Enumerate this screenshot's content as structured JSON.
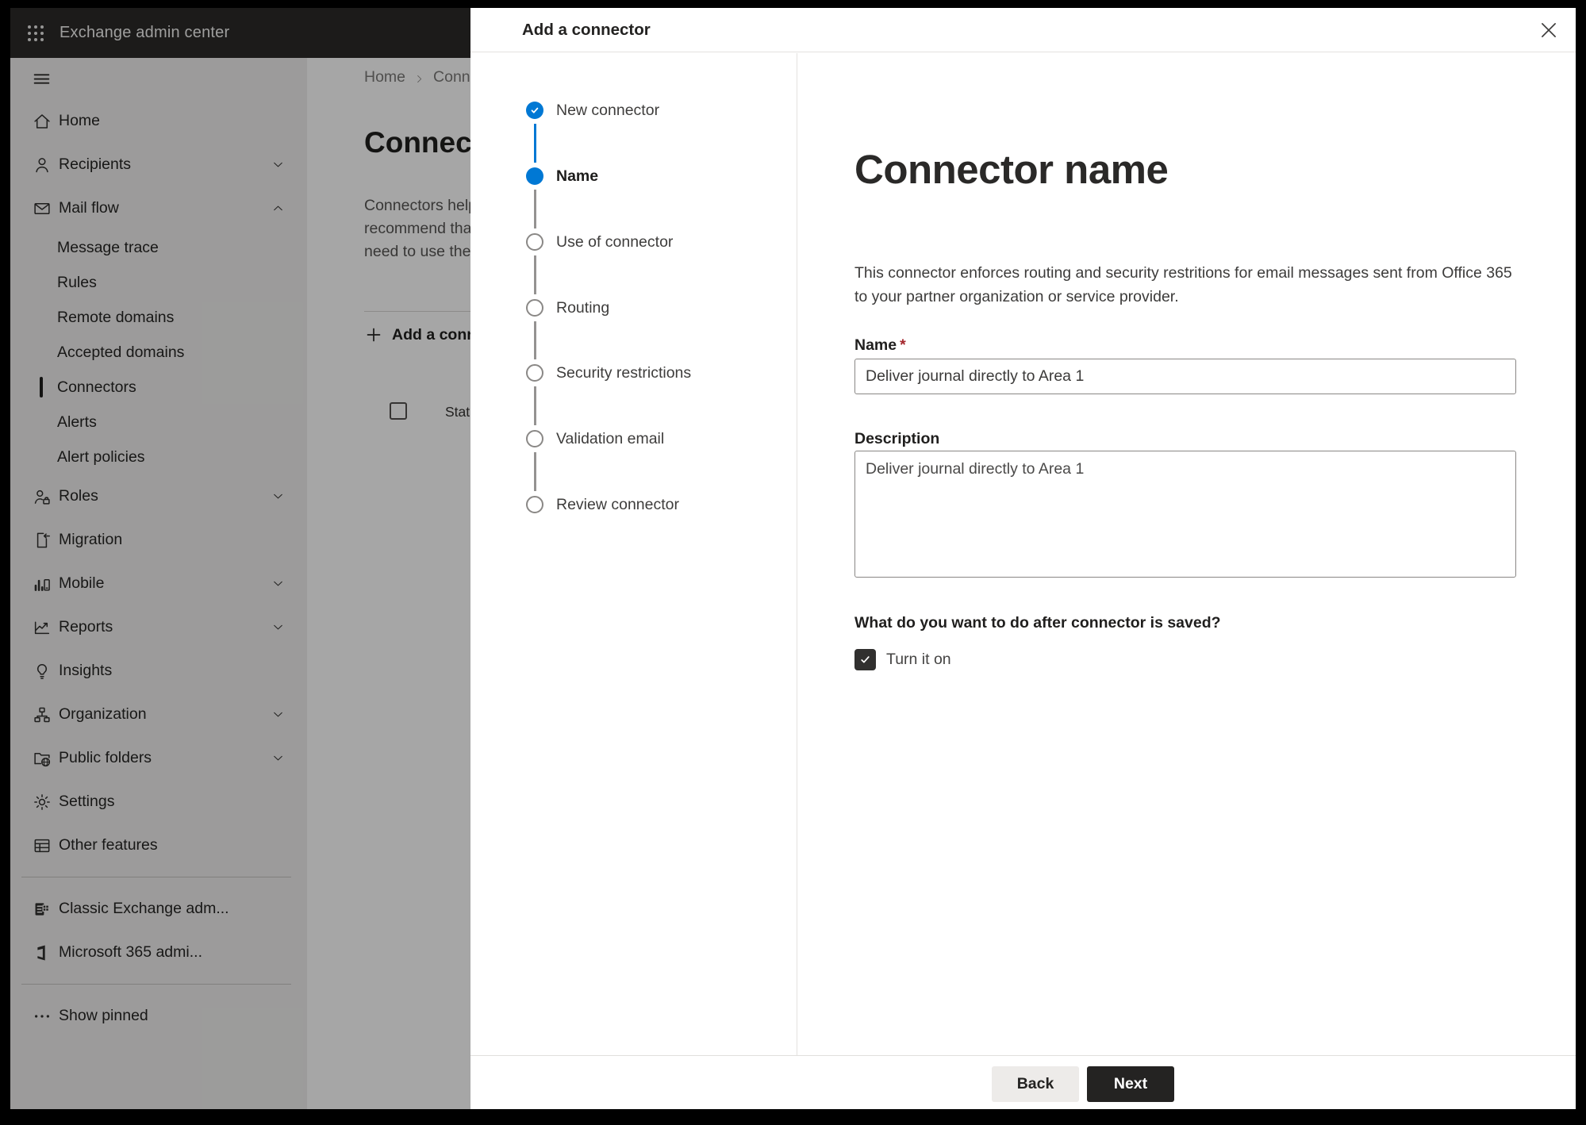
{
  "topbar": {
    "title": "Exchange admin center"
  },
  "sidebar": {
    "items": [
      {
        "type": "top",
        "label": "Home",
        "icon": "home-icon"
      },
      {
        "type": "top",
        "label": "Recipients",
        "icon": "person-icon",
        "chevron": "down"
      },
      {
        "type": "top",
        "label": "Mail flow",
        "icon": "mail-icon",
        "chevron": "up"
      },
      {
        "type": "sub",
        "label": "Message trace"
      },
      {
        "type": "sub",
        "label": "Rules"
      },
      {
        "type": "sub",
        "label": "Remote domains"
      },
      {
        "type": "sub",
        "label": "Accepted domains"
      },
      {
        "type": "sub",
        "label": "Connectors",
        "selected": true
      },
      {
        "type": "sub",
        "label": "Alerts"
      },
      {
        "type": "sub",
        "label": "Alert policies"
      },
      {
        "type": "top",
        "label": "Roles",
        "icon": "roles-icon",
        "chevron": "down"
      },
      {
        "type": "top",
        "label": "Migration",
        "icon": "migration-icon"
      },
      {
        "type": "top",
        "label": "Mobile",
        "icon": "mobile-icon",
        "chevron": "down"
      },
      {
        "type": "top",
        "label": "Reports",
        "icon": "reports-icon",
        "chevron": "down"
      },
      {
        "type": "top",
        "label": "Insights",
        "icon": "insights-icon"
      },
      {
        "type": "top",
        "label": "Organization",
        "icon": "organization-icon",
        "chevron": "down"
      },
      {
        "type": "top",
        "label": "Public folders",
        "icon": "public-folders-icon",
        "chevron": "down"
      },
      {
        "type": "top",
        "label": "Settings",
        "icon": "settings-icon"
      },
      {
        "type": "top",
        "label": "Other features",
        "icon": "other-features-icon"
      },
      {
        "type": "divider"
      },
      {
        "type": "top",
        "label": "Classic Exchange adm...",
        "icon": "classic-exchange-icon"
      },
      {
        "type": "top",
        "label": "Microsoft 365 admi...",
        "icon": "m365-icon"
      },
      {
        "type": "divider"
      },
      {
        "type": "top",
        "label": "Show pinned",
        "icon": "more-icon"
      }
    ]
  },
  "page": {
    "breadcrumb": [
      {
        "label": "Home"
      },
      {
        "label": "Conne"
      }
    ],
    "title": "Connec",
    "description_lines": [
      "Connectors help",
      "recommend that",
      "need to use ther"
    ],
    "add_button": "Add a conn",
    "table": {
      "status_header": "Status"
    }
  },
  "dialog": {
    "title": "Add a connector",
    "steps": [
      {
        "label": "New connector",
        "state": "done"
      },
      {
        "label": "Name",
        "state": "current"
      },
      {
        "label": "Use of connector",
        "state": "upcoming"
      },
      {
        "label": "Routing",
        "state": "upcoming"
      },
      {
        "label": "Security restrictions",
        "state": "upcoming"
      },
      {
        "label": "Validation email",
        "state": "upcoming"
      },
      {
        "label": "Review connector",
        "state": "upcoming"
      }
    ],
    "content": {
      "heading": "Connector name",
      "description": "This connector enforces routing and security restritions for email messages sent from Office 365 to your partner organization or service provider.",
      "name_label": "Name",
      "required_marker": "*",
      "name_value": "Deliver journal directly to Area 1",
      "description_label": "Description",
      "description_value": "Deliver journal directly to Area 1",
      "question": "What do you want to do after connector is saved?",
      "turn_on_label": "Turn it on",
      "turn_on_checked": true
    },
    "footer": {
      "back": "Back",
      "next": "Next"
    }
  },
  "colors": {
    "accent": "#0078d4",
    "topbar_bg": "#2b2a29",
    "primary_button": "#242322",
    "danger": "#a4262c"
  }
}
